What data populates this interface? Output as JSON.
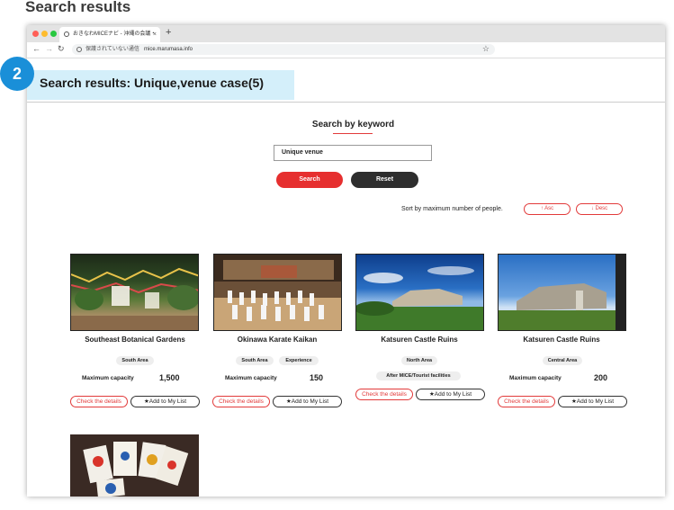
{
  "page_heading": "Search results",
  "badge_number": "2",
  "browser": {
    "tab_title": "おきなわMICEナビ - 沖縄の会議・",
    "tab_close": "×",
    "new_tab": "+",
    "not_secure": "保護されていない通信",
    "url": "mice.marumasa.info",
    "colors": {
      "close": "#ff5f57",
      "minimize": "#febc2e",
      "maximize": "#28c840"
    }
  },
  "results": {
    "title": "Search results: Unique,venue case(5)"
  },
  "search": {
    "heading": "Search by keyword",
    "input_value": "Unique venue",
    "search_label": "Search",
    "reset_label": "Reset"
  },
  "sort": {
    "label": "Sort by maximum number of people.",
    "asc_label": "Asc",
    "desc_label": "Desc"
  },
  "cards": [
    {
      "name": "Southeast Botanical Gardens",
      "tags": [
        "South Area"
      ],
      "capacity_label": "Maximum capacity",
      "capacity": "1,500",
      "detail_label": "Check the details",
      "list_label": "★Add to My List"
    },
    {
      "name": "Okinawa Karate Kaikan",
      "tags": [
        "South Area",
        "Experience"
      ],
      "capacity_label": "Maximum capacity",
      "capacity": "150",
      "detail_label": "Check the details",
      "list_label": "★Add to My List"
    },
    {
      "name": "Katsuren Castle Ruins",
      "tags": [
        "North Area",
        "After MICE/Tourist facilities"
      ],
      "detail_label": "Check the details",
      "list_label": "★Add to My List"
    },
    {
      "name": "Katsuren Castle Ruins",
      "tags": [
        "Central Area"
      ],
      "capacity_label": "Maximum capacity",
      "capacity": "200",
      "detail_label": "Check the details",
      "list_label": "★Add to My List"
    }
  ],
  "colors": {
    "accent_red": "#e62f2f",
    "badge_blue": "#1a8fd8",
    "banner_bg": "#d4effa"
  }
}
